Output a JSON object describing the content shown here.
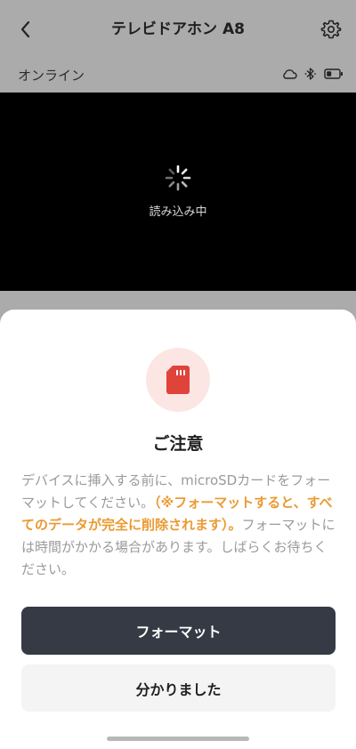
{
  "header": {
    "title": "テレビドアホン A8",
    "back_icon": "chevron-left-icon",
    "settings_icon": "gear-icon"
  },
  "status": {
    "connection": "オンライン",
    "icons": [
      "cloud-icon",
      "bluetooth-icon",
      "battery-icon"
    ]
  },
  "video": {
    "loading_text": "読み込み中"
  },
  "dialog": {
    "icon": "sd-card-icon",
    "title": "ご注意",
    "message_part1": "デバイスに挿入する前に、microSDカードをフォーマットしてください。",
    "message_warning": "（※フォーマットすると、すべてのデータが完全に削除されます）。",
    "message_part2": "フォーマットには時間がかかる場合があります。しばらくお待ちください。",
    "primary_button": "フォーマット",
    "secondary_button": "分かりました"
  },
  "colors": {
    "accent_warning": "#ea9a32",
    "primary_button_bg": "#353a45",
    "sd_icon": "#e0433a",
    "sd_badge_bg": "#fbe6e4"
  }
}
